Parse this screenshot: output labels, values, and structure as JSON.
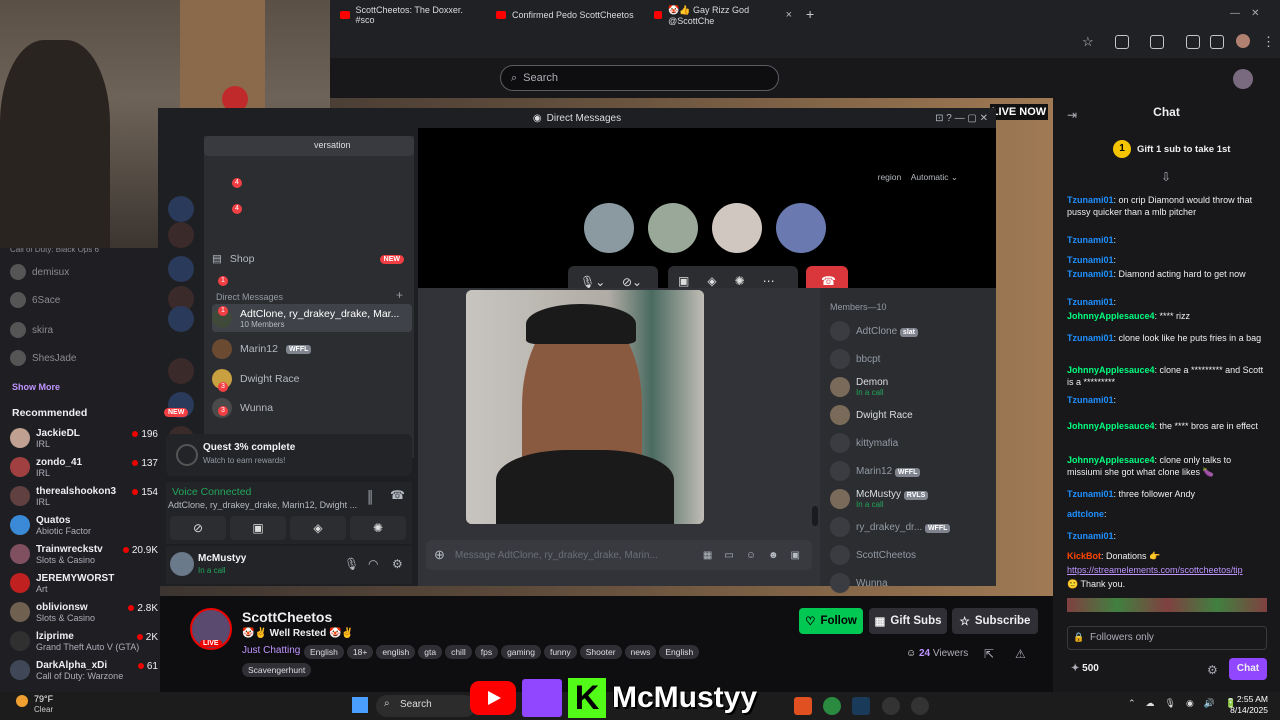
{
  "browser": {
    "tabs": [
      {
        "label": "ScottCheetos: The Doxxer. #sco"
      },
      {
        "label": "Confirmed Pedo ScottCheetos"
      },
      {
        "label": "🤡👍 Gay Rizz God @ScottChe"
      }
    ],
    "new_tab": "+"
  },
  "twitch": {
    "search_placeholder": "Search",
    "live_now": "LIVE NOW"
  },
  "sidebar": {
    "followed": [
      {
        "name": "Call of Duty: Black Ops 6"
      },
      {
        "name": "demisux"
      },
      {
        "name": "6Sace"
      },
      {
        "name": "skira"
      },
      {
        "name": "ShesJade"
      }
    ],
    "show_more": "Show More",
    "recommended_title": "Recommended",
    "recommended": [
      {
        "name": "JackieDL",
        "category": "IRL",
        "viewers": "196",
        "color": "#c0a090"
      },
      {
        "name": "zondo_41",
        "category": "IRL",
        "viewers": "137",
        "color": "#a04040"
      },
      {
        "name": "therealshookon3",
        "category": "IRL",
        "viewers": "154",
        "color": "#604040"
      },
      {
        "name": "Quatos",
        "category": "Abiotic Factor",
        "viewers": "",
        "color": "#3a8ad8"
      },
      {
        "name": "Trainwreckstv",
        "category": "Slots & Casino",
        "viewers": "20.9K",
        "color": "#805060"
      },
      {
        "name": "JEREMYWORST",
        "category": "Art",
        "viewers": "",
        "color": "#c02020"
      },
      {
        "name": "oblivionsw",
        "category": "Slots & Casino",
        "viewers": "2.8K",
        "color": "#706050"
      },
      {
        "name": "lziprime",
        "category": "Grand Theft Auto V (GTA)",
        "viewers": "2K",
        "color": "#303030"
      },
      {
        "name": "DarkAlpha_xDi",
        "category": "Call of Duty: Warzone",
        "viewers": "61",
        "color": "#404858"
      }
    ]
  },
  "discord": {
    "title": "Direct Messages",
    "conversation_label": "versation",
    "call_region_label": "region",
    "call_region_value": "Automatic",
    "shop": "Shop",
    "new_badge": "NEW",
    "dm_header": "Direct Messages",
    "server_badges": [
      "4",
      "4",
      "1",
      "1",
      "3",
      "3",
      "NEW"
    ],
    "dms": [
      {
        "name": "AdtClone, ry_drakey_drake, Mar...",
        "sub": "10 Members"
      },
      {
        "name": "Marin12",
        "tag": "WFFL"
      },
      {
        "name": "Dwight Race"
      },
      {
        "name": "Wunna"
      }
    ],
    "quest_title": "Quest 3% complete",
    "quest_sub": "Watch to earn rewards!",
    "voice_status": "Voice Connected",
    "voice_channel": "AdtClone, ry_drakey_drake, Marin12, Dwight ...",
    "user_name": "McMustyy",
    "user_status": "In a call",
    "members_header": "Members—10",
    "members": [
      {
        "name": "AdtClone",
        "tag": "slat",
        "online": false
      },
      {
        "name": "bbcpt",
        "online": false
      },
      {
        "name": "Demon",
        "status": "In a call",
        "online": true
      },
      {
        "name": "Dwight Race",
        "online": true
      },
      {
        "name": "kittymafia",
        "online": false
      },
      {
        "name": "Marin12",
        "tag": "WFFL",
        "online": false
      },
      {
        "name": "McMustyy",
        "tag": "RVLS",
        "status": "In a call",
        "online": true
      },
      {
        "name": "ry_drakey_dr...",
        "tag": "WFFL",
        "online": false
      },
      {
        "name": "ScottCheetos",
        "online": false
      },
      {
        "name": "Wunna",
        "online": false
      }
    ],
    "message_placeholder": "Message AdtClone, ry_drakey_drake, Marin..."
  },
  "chat": {
    "title": "Chat",
    "gift_banner": "Gift 1 sub to take 1st",
    "messages": [
      {
        "user": "Tzunami01",
        "cls": "u1",
        "text": ": on crip Diamond would throw that pussy quicker than a mlb pitcher"
      },
      {
        "user": "Tzunami01",
        "cls": "u1",
        "text": ":"
      },
      {
        "user": "Tzunami01",
        "cls": "u1",
        "text": ":"
      },
      {
        "user": "Tzunami01",
        "cls": "u1",
        "text": ": Diamond acting hard to get now"
      },
      {
        "user": "Tzunami01",
        "cls": "u1",
        "text": ":"
      },
      {
        "user": "JohnnyApplesauce4",
        "cls": "u2",
        "text": ": **** rizz"
      },
      {
        "user": "Tzunami01",
        "cls": "u1",
        "text": ": clone look like he puts fries in a bag"
      },
      {
        "user": "JohnnyApplesauce4",
        "cls": "u2",
        "text": ": clone a ********* and Scott is a *********"
      },
      {
        "user": "Tzunami01",
        "cls": "u1",
        "text": ":"
      },
      {
        "user": "JohnnyApplesauce4",
        "cls": "u2",
        "text": ": the **** bros are in effect"
      },
      {
        "user": "JohnnyApplesauce4",
        "cls": "u2",
        "text": ": clone only talks to missiumi she got what clone likes 🍆"
      },
      {
        "user": "Tzunami01",
        "cls": "u1",
        "text": ": three follower Andy"
      },
      {
        "user": "adtclone",
        "cls": "u1",
        "text": ":"
      },
      {
        "user": "Tzunami01",
        "cls": "u1",
        "text": ":"
      },
      {
        "user": "KickBot",
        "cls": "u3",
        "text": ": Donations 👉"
      }
    ],
    "link": "https://streamelements.com/scottcheetos/tip",
    "thanks": "🙂 Thank you.",
    "followers_only": "Followers only",
    "points": "500",
    "send": "Chat"
  },
  "stream": {
    "channel": "ScottCheetos",
    "title": "🤡✌ Well Rested 🤡✌",
    "category": "Just Chatting",
    "tags": [
      "English",
      "18+",
      "english",
      "gta",
      "chill",
      "fps",
      "gaming",
      "funny",
      "Shooter",
      "news",
      "English",
      "Scavengerhunt"
    ],
    "viewers": "24",
    "viewers_label": "Viewers",
    "follow": "Follow",
    "gift_subs": "Gift Subs",
    "subscribe": "Subscribe",
    "live_badge": "LIVE"
  },
  "overlay": {
    "name": "McMustyy"
  },
  "taskbar": {
    "weather_temp": "79°F",
    "weather_desc": "Clear",
    "search": "Search",
    "time": "2:55 AM",
    "date": "8/14/2025"
  }
}
